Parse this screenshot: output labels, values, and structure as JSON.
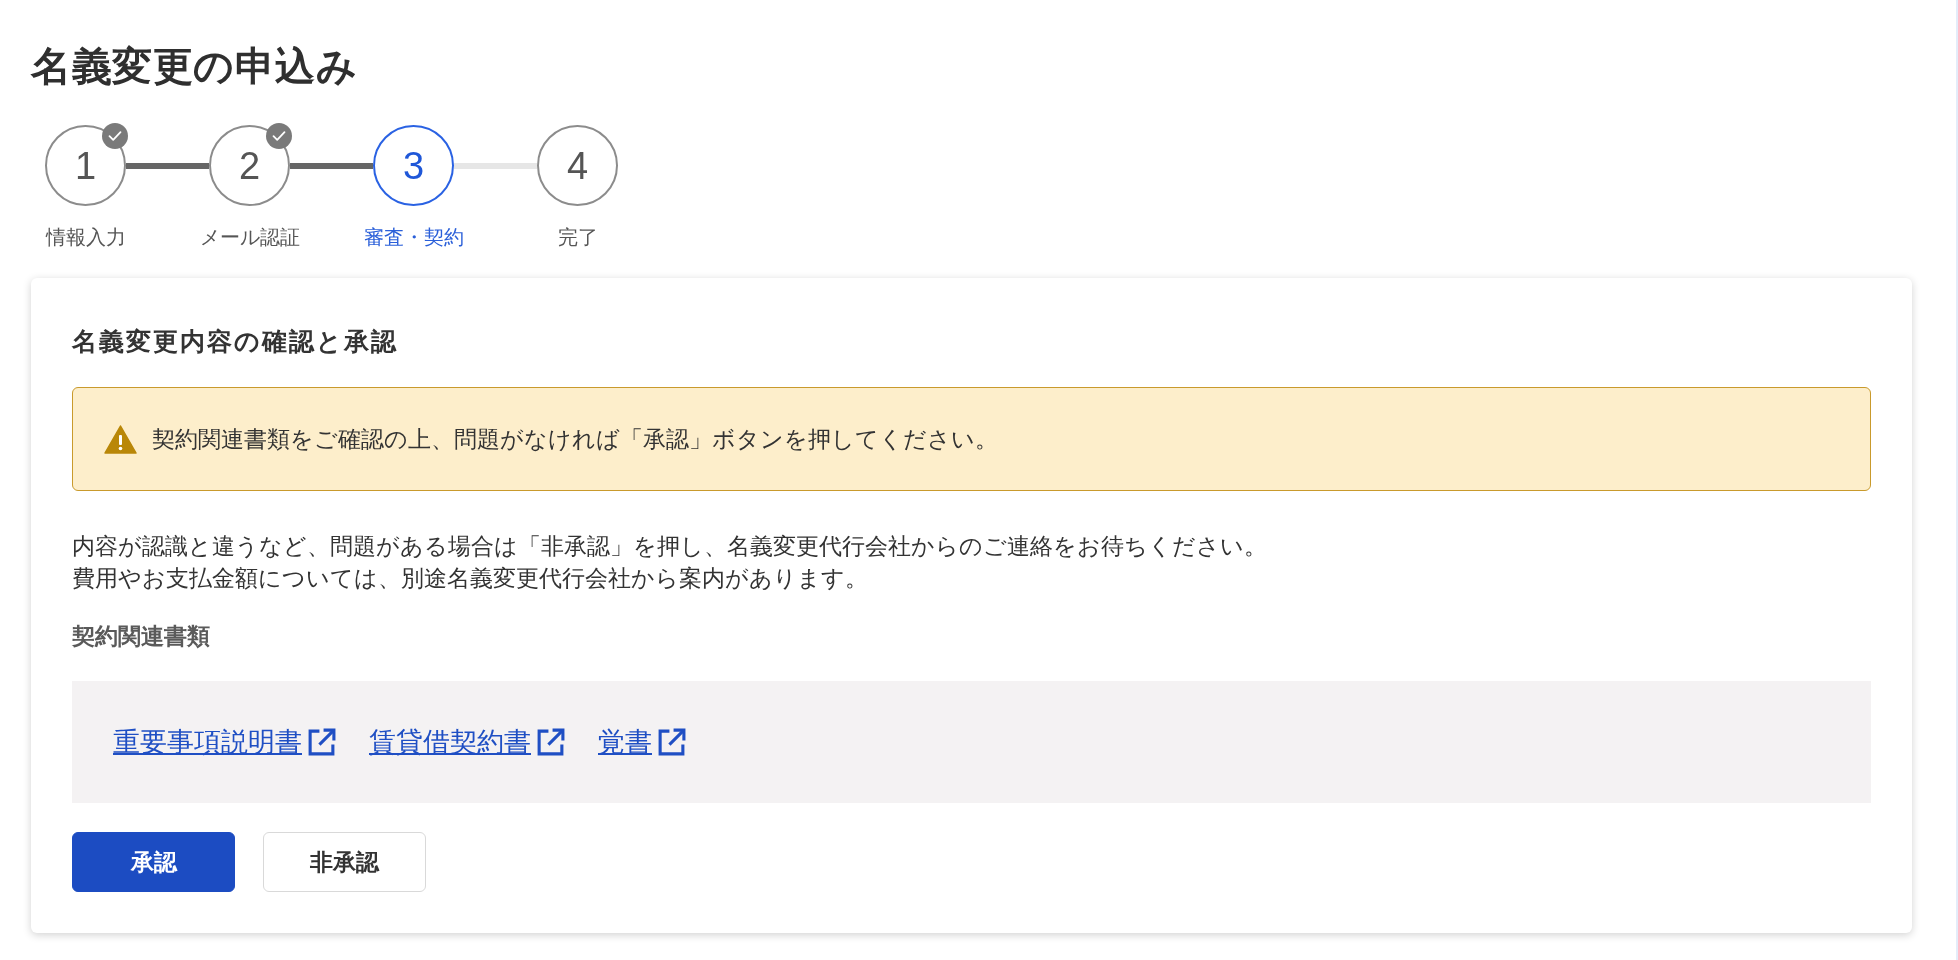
{
  "page": {
    "title": "名義変更の申込み"
  },
  "steps": [
    {
      "number": "1",
      "label": "情報入力",
      "completed": true,
      "current": false
    },
    {
      "number": "2",
      "label": "メール認証",
      "completed": true,
      "current": false
    },
    {
      "number": "3",
      "label": "審査・契約",
      "completed": false,
      "current": true
    },
    {
      "number": "4",
      "label": "完了",
      "completed": false,
      "current": false
    }
  ],
  "card": {
    "heading": "名義変更内容の確認と承認",
    "alert": {
      "kind": "warning",
      "text": "契約関連書類をご確認の上、問題がなければ「承認」ボタンを押してください。"
    },
    "paragraphs": [
      "内容が認識と違うなど、問題がある場合は「非承認」を押し、名義変更代行会社からのご連絡をお待ちください。",
      "費用やお支払金額については、別途名義変更代行会社から案内があります。"
    ],
    "documents": {
      "heading": "契約関連書類",
      "links": [
        "重要事項説明書",
        "賃貸借契約書",
        "覚書"
      ]
    },
    "buttons": [
      {
        "label": "承認",
        "kind": "primary"
      },
      {
        "label": "非承認",
        "kind": "secondary"
      }
    ]
  }
}
